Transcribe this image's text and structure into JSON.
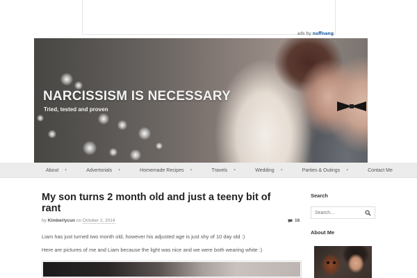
{
  "ad": {
    "brand_prefix": "ads by",
    "brand_name": "nuffnang"
  },
  "header": {
    "site_title": "NARCISSISM IS NECESSARY",
    "tagline": "Tried, tested and proven"
  },
  "nav": {
    "items": [
      {
        "label": "About",
        "has_dropdown": true
      },
      {
        "label": "Advertorials",
        "has_dropdown": true
      },
      {
        "label": "Homemade Recipes",
        "has_dropdown": true
      },
      {
        "label": "Travels",
        "has_dropdown": true
      },
      {
        "label": "Wedding",
        "has_dropdown": true
      },
      {
        "label": "Parties & Outings",
        "has_dropdown": true
      },
      {
        "label": "Contact Me",
        "has_dropdown": false
      }
    ],
    "caret": "▼"
  },
  "post": {
    "title": "My son turns 2 month old and just a teeny bit of rant",
    "meta_by": "by",
    "author": "Kimberlycun",
    "meta_on": "on",
    "date": "October 2, 2014",
    "comment_count": "16",
    "paragraph_1": "Liam has just turned two month old, however his adjusted age is just shy of 10 day old :)",
    "paragraph_2": "Here are pictures of me and Liam because the light was nice and we were both wearing white :)"
  },
  "sidebar": {
    "search_title": "Search",
    "search_placeholder": "Search...",
    "about_title": "About Me"
  },
  "colors": {
    "nav_background": "#ececec",
    "title_text": "#222222",
    "banner_text": "#f2f2f2"
  }
}
